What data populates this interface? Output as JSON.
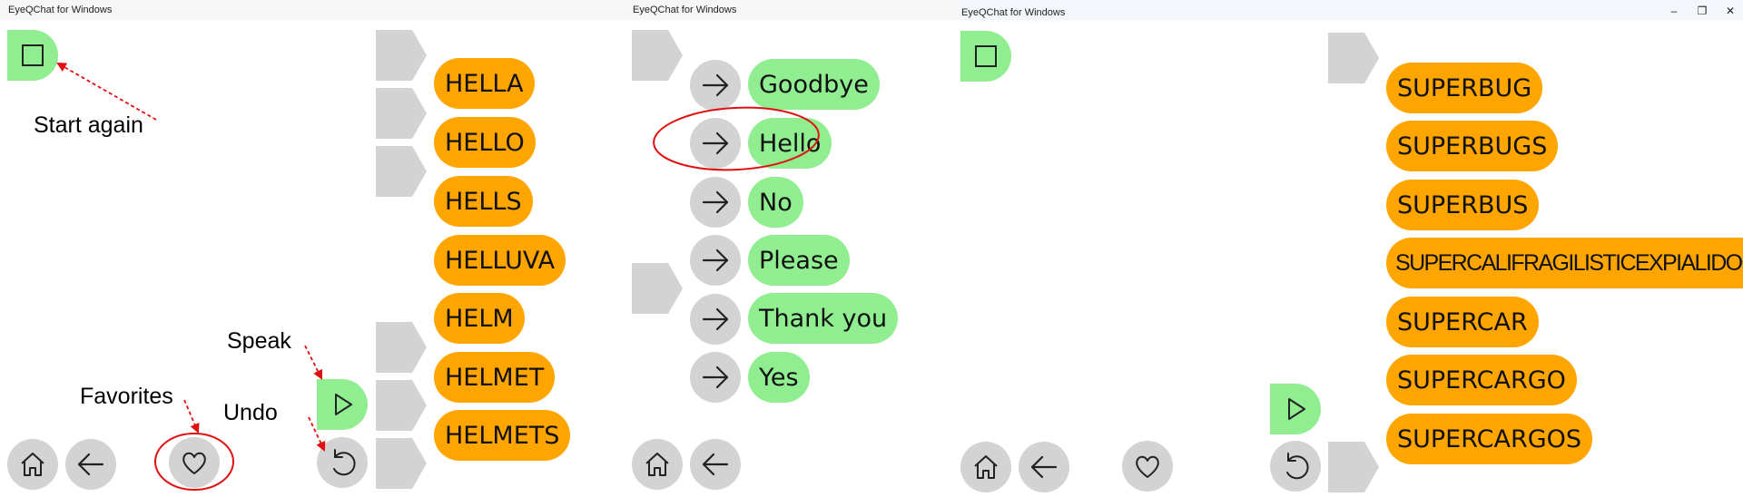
{
  "window_title": "EyeQChat for Windows",
  "panel1": {
    "annotations": {
      "start_again": "Start again",
      "speak": "Speak",
      "favorites": "Favorites",
      "undo": "Undo"
    },
    "word_suggestions": [
      "HELLA",
      "HELLO",
      "HELLS",
      "HELLUVA",
      "HELM",
      "HELMET",
      "HELMETS"
    ]
  },
  "panel2": {
    "phrases": [
      "Goodbye",
      "Hello",
      "No",
      "Please",
      "Thank you",
      "Yes"
    ]
  },
  "panel3": {
    "word_suggestions": [
      "SUPERBUG",
      "SUPERBUGS",
      "SUPERBUS",
      "SUPERCALIFRAGILISTICEXPIALIDOCIOUS",
      "SUPERCAR",
      "SUPERCARGO",
      "SUPERCARGOS"
    ]
  },
  "window_controls": {
    "minimize": "–",
    "restore": "❐",
    "close": "✕"
  },
  "colors": {
    "green": "#90ee90",
    "orange": "#ffa500",
    "gray": "#d3d3d3",
    "annotation_red": "#e01010"
  }
}
